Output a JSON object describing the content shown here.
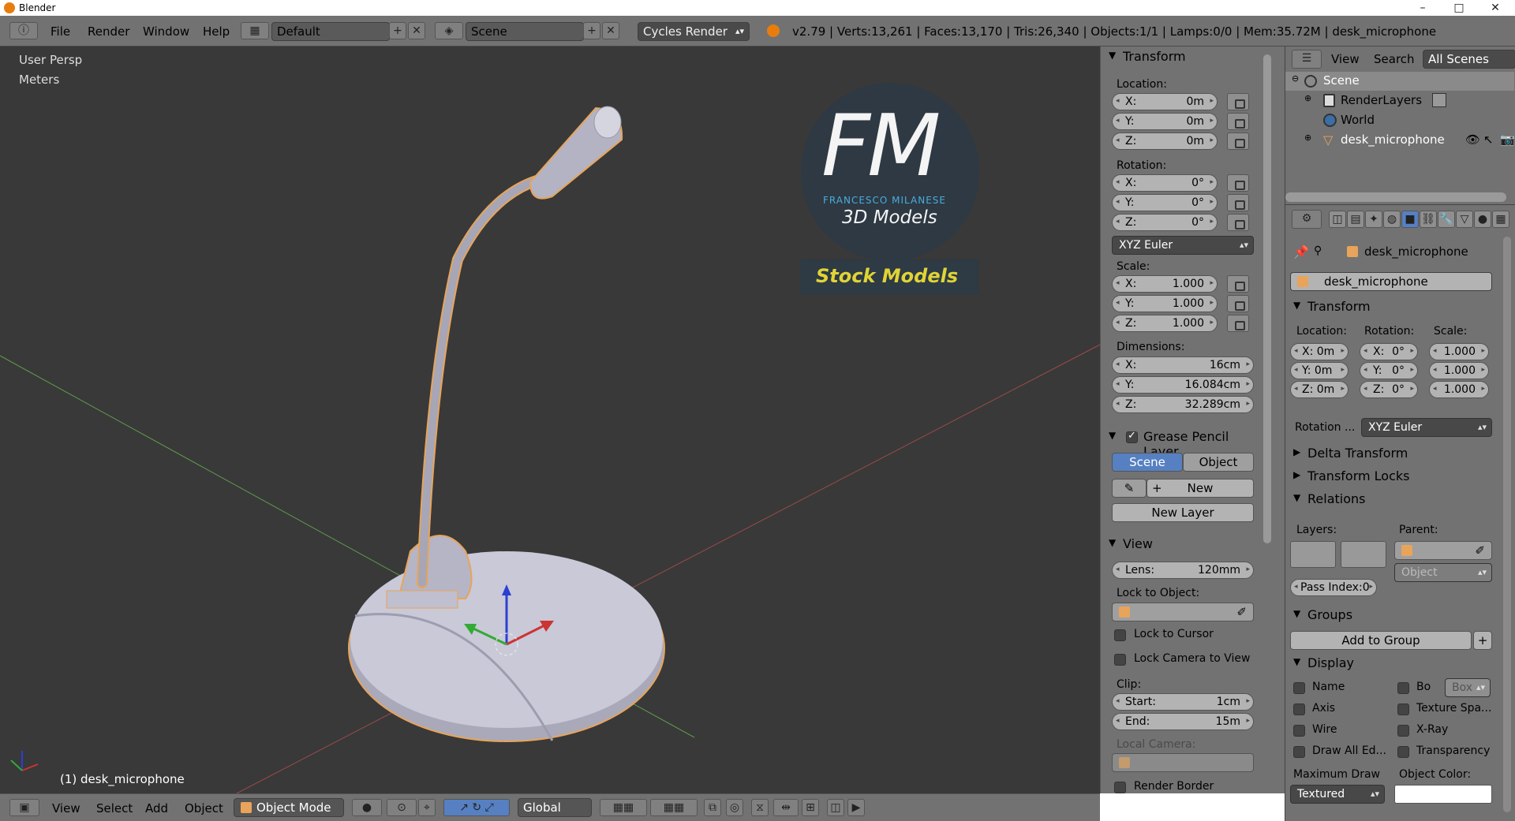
{
  "window": {
    "title": "Blender",
    "controls": [
      "–",
      "□",
      "✕"
    ]
  },
  "topbar": {
    "menus": [
      "File",
      "Render",
      "Window",
      "Help"
    ],
    "layout": "Default",
    "scene": "Scene",
    "engine": "Cycles Render",
    "stats": "v2.79 | Verts:13,261 | Faces:13,170 | Tris:26,340 | Objects:1/1 | Lamps:0/0 | Mem:35.72M | desk_microphone"
  },
  "viewport": {
    "view_name": "User Persp",
    "units": "Meters",
    "object_label": "(1) desk_microphone",
    "watermark": {
      "big": "FM",
      "name": "FRANCESCO MILANESE",
      "sub": "3D Models",
      "stock": "Stock Models"
    },
    "colors": {
      "bg": "#393939",
      "mesh": "#c8c8d8",
      "outline": "#e8a45a",
      "brand": "#4ab3e8",
      "stock": "#e0d436"
    }
  },
  "bottombar": {
    "menus": [
      "View",
      "Select",
      "Add",
      "Object"
    ],
    "mode": "Object Mode",
    "orientation": "Global"
  },
  "npanel": {
    "transform_title": "Transform",
    "location_label": "Location:",
    "location": [
      {
        "k": "X:",
        "v": "0m"
      },
      {
        "k": "Y:",
        "v": "0m"
      },
      {
        "k": "Z:",
        "v": "0m"
      }
    ],
    "rotation_label": "Rotation:",
    "rotation": [
      {
        "k": "X:",
        "v": "0°"
      },
      {
        "k": "Y:",
        "v": "0°"
      },
      {
        "k": "Z:",
        "v": "0°"
      }
    ],
    "rotation_mode": "XYZ Euler",
    "scale_label": "Scale:",
    "scale": [
      {
        "k": "X:",
        "v": "1.000"
      },
      {
        "k": "Y:",
        "v": "1.000"
      },
      {
        "k": "Z:",
        "v": "1.000"
      }
    ],
    "dimensions_label": "Dimensions:",
    "dimensions": [
      {
        "k": "X:",
        "v": "16cm"
      },
      {
        "k": "Y:",
        "v": "16.084cm"
      },
      {
        "k": "Z:",
        "v": "32.289cm"
      }
    ],
    "gp_title": "Grease Pencil Layer",
    "gp_scene": "Scene",
    "gp_object": "Object",
    "gp_new": "New",
    "gp_new_layer": "New Layer",
    "view_title": "View",
    "lens": {
      "k": "Lens:",
      "v": "120mm"
    },
    "lock_to_object": "Lock to Object:",
    "lock_to_cursor": "Lock to Cursor",
    "lock_camera": "Lock Camera to View",
    "clip_label": "Clip:",
    "clip_start": {
      "k": "Start:",
      "v": "1cm"
    },
    "clip_end": {
      "k": "End:",
      "v": "15m"
    },
    "local_camera": "Local Camera:",
    "render_border": "Render Border"
  },
  "outliner": {
    "menus": [
      "View",
      "Search"
    ],
    "filter": "All Scenes",
    "items": [
      {
        "label": "Scene"
      },
      {
        "label": "RenderLayers"
      },
      {
        "label": "World"
      },
      {
        "label": "desk_microphone"
      }
    ]
  },
  "properties": {
    "breadcrumb": "desk_microphone",
    "object_name": "desk_microphone",
    "transform_title": "Transform",
    "location_label": "Location:",
    "rotation_label": "Rotation:",
    "scale_label": "Scale:",
    "loc": [
      "X: 0m",
      "Y: 0m",
      "Z: 0m"
    ],
    "rot": [
      {
        "k": "X:",
        "v": "0°"
      },
      {
        "k": "Y:",
        "v": "0°"
      },
      {
        "k": "Z:",
        "v": "0°"
      }
    ],
    "scl": [
      "1.000",
      "1.000",
      "1.000"
    ],
    "rotation_mode_label": "Rotation ...",
    "rotation_mode": "XYZ Euler",
    "delta_transform": "Delta Transform",
    "transform_locks": "Transform Locks",
    "relations": "Relations",
    "layers_label": "Layers:",
    "parent_label": "Parent:",
    "parent_type": "Object",
    "pass_index": "Pass Index:0",
    "groups": "Groups",
    "add_to_group": "Add to Group",
    "display": "Display",
    "display_left": [
      "Name",
      "Axis",
      "Wire",
      "Draw All Ed..."
    ],
    "display_right": [
      "Bo",
      "Texture Spa...",
      "X-Ray",
      "Transparency"
    ],
    "bounds_type": "Box",
    "max_draw_label": "Maximum Draw",
    "max_draw": "Textured",
    "object_color_label": "Object Color:"
  }
}
